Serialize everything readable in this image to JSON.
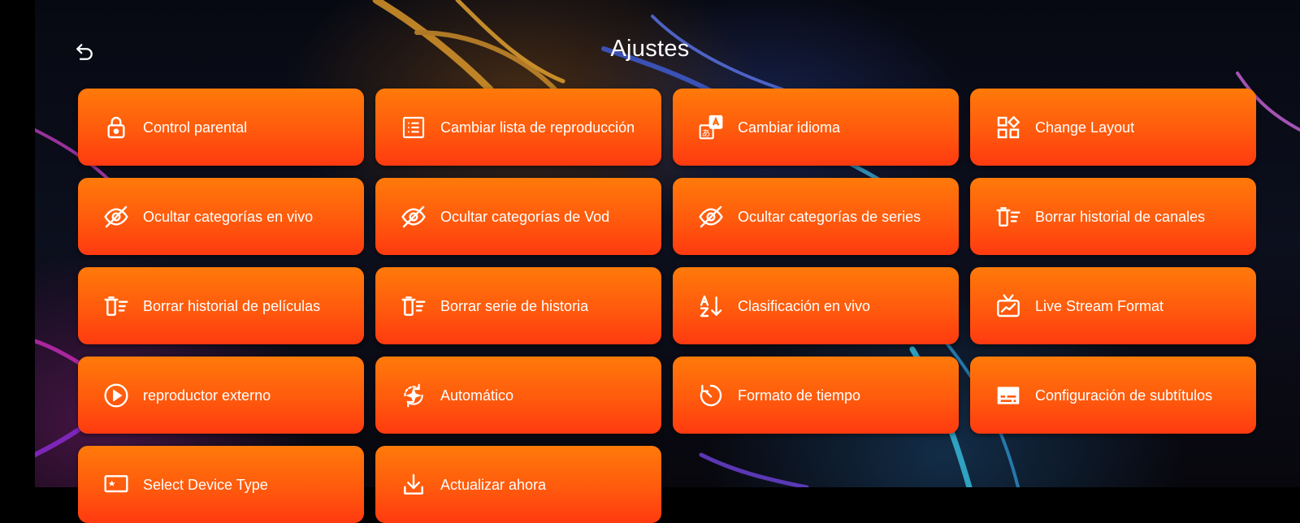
{
  "header": {
    "title": "Ajustes",
    "back_icon": "back-arrow-icon"
  },
  "tiles": [
    {
      "name": "tile-control-parental",
      "label": "Control parental",
      "icon": "lock-icon"
    },
    {
      "name": "tile-cambiar-lista",
      "label": "Cambiar lista de reproducción",
      "icon": "list-icon"
    },
    {
      "name": "tile-cambiar-idioma",
      "label": "Cambiar idioma",
      "icon": "translate-icon"
    },
    {
      "name": "tile-change-layout",
      "label": "Change Layout",
      "icon": "layout-icon"
    },
    {
      "name": "tile-ocultar-vivo",
      "label": "Ocultar categorías en vivo",
      "icon": "eye-off-icon"
    },
    {
      "name": "tile-ocultar-vod",
      "label": "Ocultar categorías de Vod",
      "icon": "eye-off-icon"
    },
    {
      "name": "tile-ocultar-series",
      "label": "Ocultar categorías de series",
      "icon": "eye-off-icon"
    },
    {
      "name": "tile-borrar-canales",
      "label": "Borrar historial de canales",
      "icon": "delete-list-icon"
    },
    {
      "name": "tile-borrar-peliculas",
      "label": "Borrar historial de películas",
      "icon": "delete-list-icon"
    },
    {
      "name": "tile-borrar-serie",
      "label": "Borrar serie de historia",
      "icon": "delete-list-icon"
    },
    {
      "name": "tile-clasificacion",
      "label": "Clasificación en vivo",
      "icon": "sort-az-icon"
    },
    {
      "name": "tile-live-stream-format",
      "label": "Live Stream Format",
      "icon": "live-tv-icon"
    },
    {
      "name": "tile-reproductor-externo",
      "label": "reproductor externo",
      "icon": "play-circle-icon"
    },
    {
      "name": "tile-automatico",
      "label": "Automático",
      "icon": "auto-refresh-icon"
    },
    {
      "name": "tile-formato-tiempo",
      "label": "Formato de tiempo",
      "icon": "timer-icon"
    },
    {
      "name": "tile-subtitulos",
      "label": "Configuración de subtítulos",
      "icon": "subtitles-icon"
    },
    {
      "name": "tile-select-device",
      "label": "Select Device Type",
      "icon": "device-icon"
    },
    {
      "name": "tile-actualizar",
      "label": "Actualizar ahora",
      "icon": "download-icon"
    }
  ]
}
